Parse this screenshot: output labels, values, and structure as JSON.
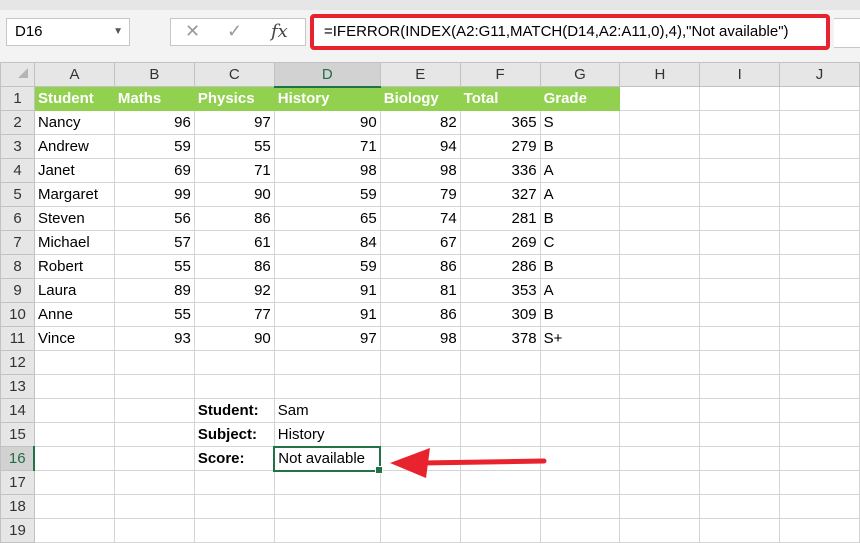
{
  "formula_bar": {
    "name_box": "D16",
    "cancel_icon": "✕",
    "enter_icon": "✓",
    "fx_label": "fx",
    "formula": "=IFERROR(INDEX(A2:G11,MATCH(D14,A2:A11,0),4),\"Not available\")"
  },
  "columns": [
    "A",
    "B",
    "C",
    "D",
    "E",
    "F",
    "G",
    "H",
    "I",
    "J"
  ],
  "selected_column": "D",
  "selected_row": 16,
  "header_row": [
    "Student",
    "Maths",
    "Physics",
    "History",
    "Biology",
    "Total",
    "Grade"
  ],
  "data_rows": [
    [
      "Nancy",
      "96",
      "97",
      "90",
      "82",
      "365",
      "S"
    ],
    [
      "Andrew",
      "59",
      "55",
      "71",
      "94",
      "279",
      "B"
    ],
    [
      "Janet",
      "69",
      "71",
      "98",
      "98",
      "336",
      "A"
    ],
    [
      "Margaret",
      "99",
      "90",
      "59",
      "79",
      "327",
      "A"
    ],
    [
      "Steven",
      "56",
      "86",
      "65",
      "74",
      "281",
      "B"
    ],
    [
      "Michael",
      "57",
      "61",
      "84",
      "67",
      "269",
      "C"
    ],
    [
      "Robert",
      "55",
      "86",
      "59",
      "86",
      "286",
      "B"
    ],
    [
      "Laura",
      "89",
      "92",
      "91",
      "81",
      "353",
      "A"
    ],
    [
      "Anne",
      "55",
      "77",
      "91",
      "86",
      "309",
      "B"
    ],
    [
      "Vince",
      "93",
      "90",
      "97",
      "98",
      "378",
      "S+"
    ]
  ],
  "lookup": {
    "student_label": "Student:",
    "student_value": "Sam",
    "subject_label": "Subject:",
    "subject_value": "History",
    "score_label": "Score:",
    "score_value": "Not available"
  },
  "colors": {
    "header_fill": "#92d050",
    "highlight_border": "#e8232e",
    "selection": "#217346"
  }
}
